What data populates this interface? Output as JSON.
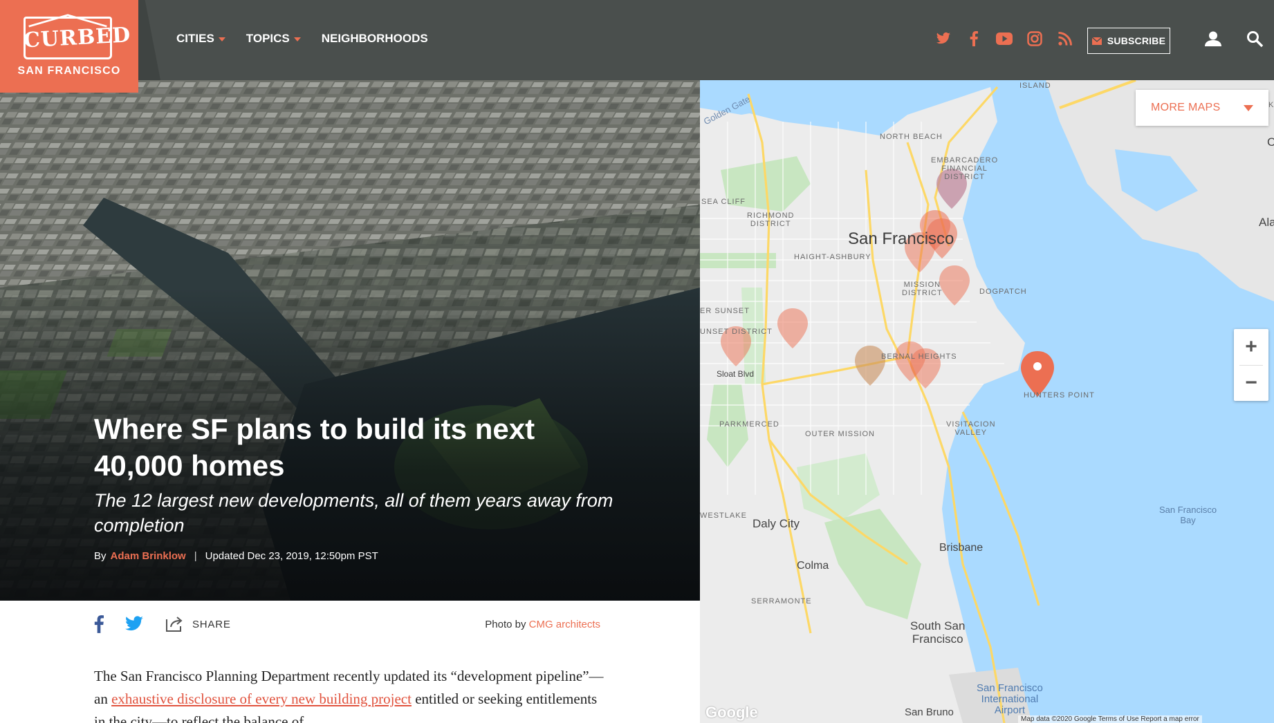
{
  "brand": {
    "logo_word": "CURBED",
    "city": "SAN FRANCISCO",
    "accent_color": "#ec6f52",
    "nav_bg": "#4a4f4d"
  },
  "nav": {
    "items": [
      {
        "label": "CITIES",
        "has_caret": true
      },
      {
        "label": "TOPICS",
        "has_caret": true
      },
      {
        "label": "NEIGHBORHOODS",
        "has_caret": false
      }
    ]
  },
  "social_icons": [
    "twitter-icon",
    "facebook-icon",
    "youtube-icon",
    "instagram-icon",
    "rss-icon"
  ],
  "subscribe_label": "SUBSCRIBE",
  "article": {
    "title": "Where SF plans to build its next 40,000 homes",
    "subtitle": "The 12 largest new developments, all of them years away from completion",
    "by": "By",
    "author": "Adam Brinklow",
    "updated": "Updated Dec 23, 2019, 12:50pm PST",
    "share_label": "SHARE",
    "photo_credit_prefix": "Photo by",
    "photo_credit_name": "CMG architects",
    "body_start": "The San Francisco Planning Department recently updated its “development pipeline”—an ",
    "body_link": "exhaustive disclosure of every new building project",
    "body_end": " entitled or seeking entitlements in the city—to reflect the balance of"
  },
  "map": {
    "more_maps_label": "MORE MAPS",
    "zoom_in": "+",
    "zoom_out": "−",
    "labels": {
      "island": "ISLAND",
      "golden_gate": "Golden Gate",
      "north_beach": "NORTH BEACH",
      "embarcadero": "EMBARCADERO\nFINANCIAL\nDISTRICT",
      "sea_cliff": "SEA CLIFF",
      "richmond": "RICHMOND\nDISTRICT",
      "san_francisco": "San Francisco",
      "haight": "HAIGHT-ASHBURY",
      "alameda": "Alame",
      "mission": "MISSION\nDISTRICT",
      "dogpatch": "DOGPATCH",
      "sunset": "ER SUNSET",
      "sunset_district": "UNSET DISTRICT",
      "bernal": "BERNAL HEIGHTS",
      "sloat": "Sloat Blvd",
      "hunters_point": "HUNTERS POINT",
      "parkmerced": "PARKMERCED",
      "outer_mission": "OUTER MISSION",
      "visitacion": "VISITACION\nVALLEY",
      "sf_bay": "San Francisco\nBay",
      "westlake": "WESTLAKE",
      "daly_city": "Daly City",
      "brisbane": "Brisbane",
      "colma": "Colma",
      "serramonte": "SERRAMONTE",
      "south_sf": "South San\nFrancisco",
      "sfo": "San Francisco\nInternational\nAirport",
      "san_bruno": "San Bruno",
      "google": "Google",
      "map_data": "Map data ©2020 Google   Terms of Use   Report a map error",
      "c": "C",
      "k": "K"
    },
    "pin_color": "#ec6f52",
    "water_color": "#aadaff"
  }
}
